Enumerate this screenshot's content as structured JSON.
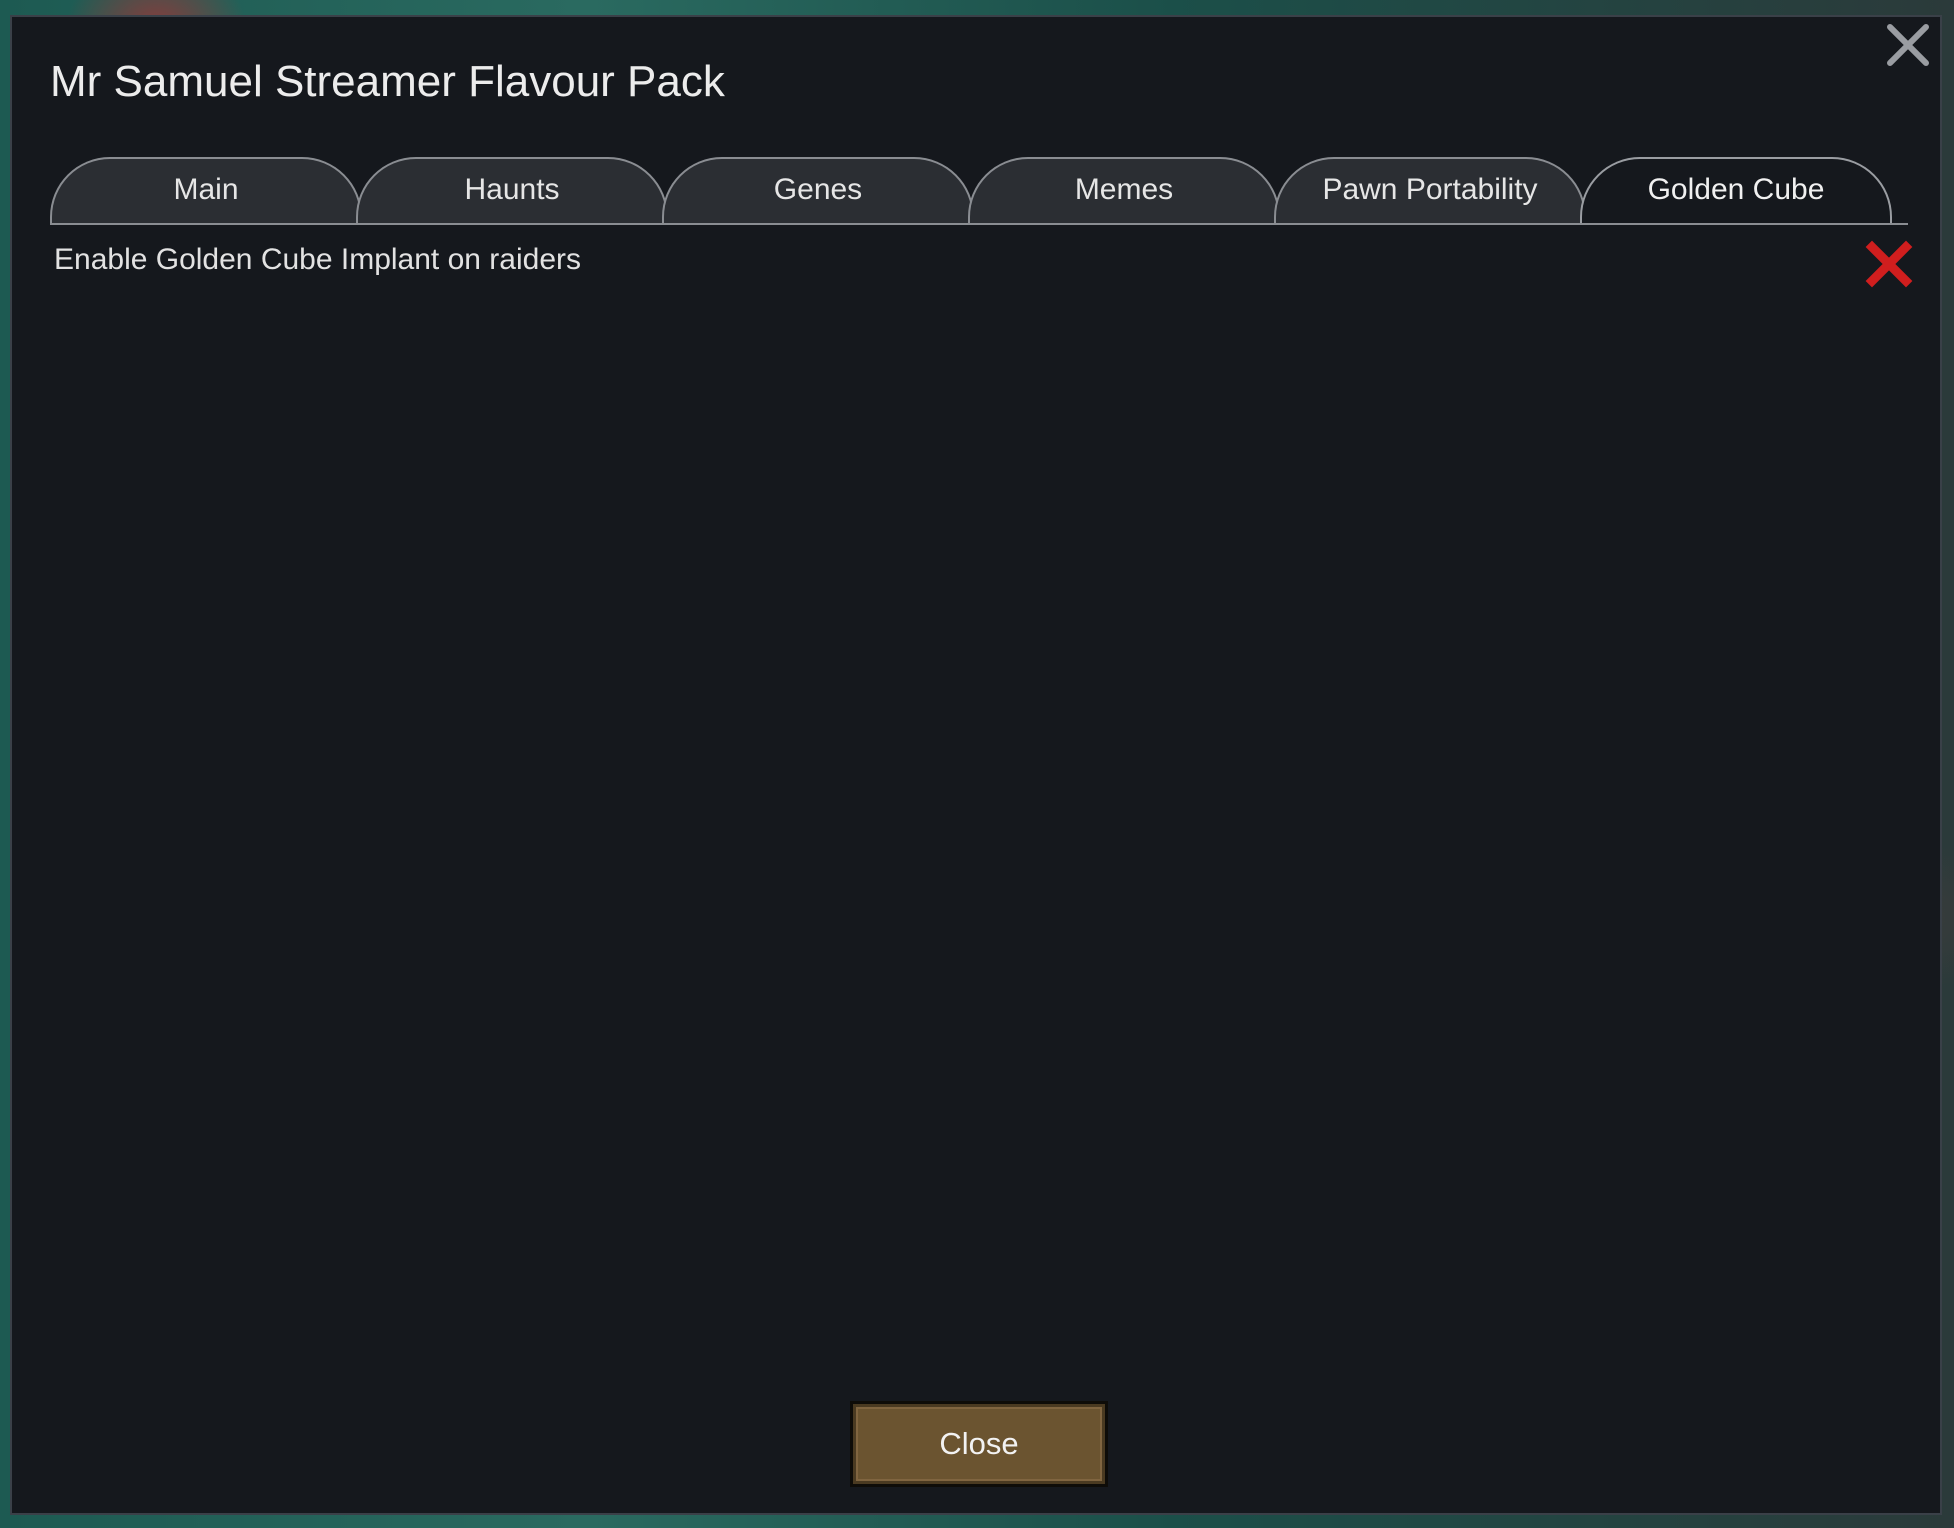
{
  "dialog": {
    "title": "Mr Samuel Streamer Flavour Pack",
    "close_icon": "close-x-icon",
    "close_button_label": "Close"
  },
  "tabs": [
    {
      "label": "Main",
      "active": false
    },
    {
      "label": "Haunts",
      "active": false
    },
    {
      "label": "Genes",
      "active": false
    },
    {
      "label": "Memes",
      "active": false
    },
    {
      "label": "Pawn Portability",
      "active": false
    },
    {
      "label": "Golden Cube",
      "active": true
    }
  ],
  "settings": [
    {
      "label": "Enable Golden Cube Implant on raiders",
      "enabled": false,
      "indicator_icon": "red-x-icon",
      "indicator_color": "#d01e1e"
    }
  ],
  "colors": {
    "dialog_bg": "#15181d",
    "tab_bg": "#2b2e33",
    "button_bg": "#6b5430"
  }
}
